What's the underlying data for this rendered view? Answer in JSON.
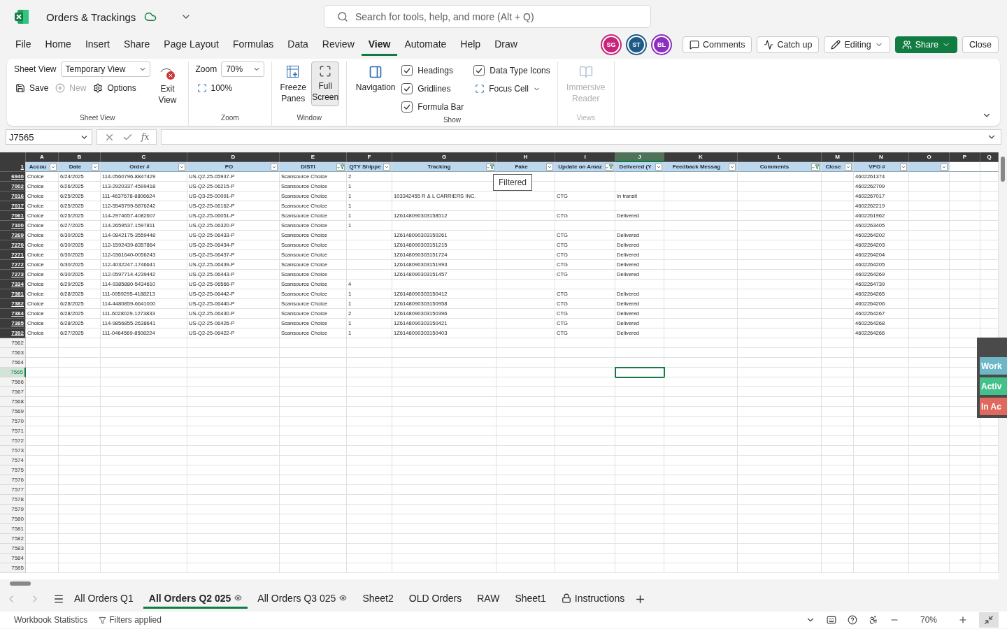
{
  "title_bar": {
    "document_title": "Orders & Trackings",
    "search_placeholder": "Search for tools, help, and more (Alt + Q)"
  },
  "menu": [
    {
      "label": "File",
      "selected": false
    },
    {
      "label": "Home",
      "selected": false
    },
    {
      "label": "Insert",
      "selected": false
    },
    {
      "label": "Share",
      "selected": false
    },
    {
      "label": "Page Layout",
      "selected": false
    },
    {
      "label": "Formulas",
      "selected": false
    },
    {
      "label": "Data",
      "selected": false
    },
    {
      "label": "Review",
      "selected": false
    },
    {
      "label": "View",
      "selected": true
    },
    {
      "label": "Automate",
      "selected": false
    },
    {
      "label": "Help",
      "selected": false
    },
    {
      "label": "Draw",
      "selected": false
    }
  ],
  "collaborators": [
    {
      "initials": "SG",
      "color": "#c8247a"
    },
    {
      "initials": "ST",
      "color": "#1d5a86"
    },
    {
      "initials": "BL",
      "color": "#8b2fc0"
    }
  ],
  "actions": [
    {
      "label": "Comments",
      "kind": "comments"
    },
    {
      "label": "Catch up",
      "kind": "catchup"
    },
    {
      "label": "Editing",
      "kind": "editing"
    },
    {
      "label": "Share",
      "kind": "primary"
    },
    {
      "label": "Close",
      "kind": "plain"
    }
  ],
  "ribbon": {
    "sheet_view": {
      "label": "Sheet View",
      "value": "Temporary View",
      "save": "Save",
      "new": {
        "label": "New",
        "disabled": true
      },
      "options": "Options",
      "exit": "Exit View",
      "group": "Sheet View"
    },
    "zoom": {
      "label": "Zoom",
      "value": "70%",
      "reset": "100%",
      "group": "Zoom"
    },
    "window": {
      "freeze": "Freeze Panes",
      "full_screen": {
        "label": "Full Screen",
        "selected": true
      },
      "group": "Window"
    },
    "show": {
      "navigation": "Navigation",
      "checkboxes": [
        {
          "label": "Headings",
          "checked": true
        },
        {
          "label": "Gridlines",
          "checked": true
        },
        {
          "label": "Formula Bar",
          "checked": true
        },
        {
          "label": "Data Type Icons",
          "checked": true
        }
      ],
      "focus_cell": "Focus Cell",
      "group": "Show"
    },
    "views": {
      "reader": {
        "label": "Immersive Reader",
        "disabled": true
      },
      "group": "Views"
    }
  },
  "formula_bar": {
    "name_box": "J7565",
    "function_label": "fx"
  },
  "sheet": {
    "header_row": "1",
    "columns": [
      {
        "letter": "A",
        "header": "Accou",
        "has_filter_button": true,
        "filtered": false,
        "selected": false
      },
      {
        "letter": "B",
        "header": "Date",
        "has_filter_button": true,
        "filtered": false,
        "selected": false
      },
      {
        "letter": "C",
        "header": "Order #",
        "has_filter_button": true,
        "filtered": false,
        "selected": false
      },
      {
        "letter": "D",
        "header": "PO",
        "has_filter_button": true,
        "filtered": false,
        "selected": false
      },
      {
        "letter": "E",
        "header": "DISTI",
        "has_filter_button": true,
        "filtered": true,
        "selected": false
      },
      {
        "letter": "F",
        "header": "QTY Shippe",
        "has_filter_button": true,
        "filtered": false,
        "selected": false
      },
      {
        "letter": "G",
        "header": "Tracking",
        "has_filter_button": true,
        "filtered": true,
        "selected": false
      },
      {
        "letter": "H",
        "header": "Fake",
        "has_filter_button": true,
        "filtered": false,
        "selected": false
      },
      {
        "letter": "I",
        "header": "Update on Amaz",
        "has_filter_button": true,
        "filtered": true,
        "selected": false
      },
      {
        "letter": "J",
        "header": "Delivered (Y",
        "has_filter_button": true,
        "filtered": false,
        "selected": true
      },
      {
        "letter": "K",
        "header": "Feedback Messag",
        "has_filter_button": true,
        "filtered": false,
        "selected": false
      },
      {
        "letter": "L",
        "header": "Comments",
        "has_filter_button": true,
        "filtered": true,
        "selected": false
      },
      {
        "letter": "M",
        "header": "Close",
        "has_filter_button": true,
        "filtered": false,
        "selected": false
      },
      {
        "letter": "N",
        "header": "VPO #",
        "has_filter_button": true,
        "filtered": false,
        "selected": false
      },
      {
        "letter": "O",
        "has_filter_button": true,
        "filtered": false,
        "selected": false
      },
      {
        "letter": "P",
        "has_filter_button": false,
        "selected": false
      },
      {
        "letter": "Q",
        "has_filter_button": false,
        "selected": false
      }
    ],
    "rows": [
      {
        "num": "6940",
        "cells": {
          "A": "Choice",
          "B": "6/24/2025",
          "C": "114-0560796-8847429",
          "D": "US-Q2-25-05937-P",
          "E": "Scansource Choice",
          "F": "2",
          "N": "4602261374"
        }
      },
      {
        "num": "7002",
        "cells": {
          "A": "Choice",
          "B": "6/26/2025",
          "C": "113-2920337-4599418",
          "D": "US-Q2-25-06215-P",
          "E": "Scansource Choice",
          "F": "1",
          "N": "4602262709"
        }
      },
      {
        "num": "7016",
        "cells": {
          "A": "Choice",
          "B": "6/25/2025",
          "C": "111-4637678-8806624",
          "D": "US-Q3-25-00091-P",
          "E": "Scansource Choice",
          "F": "1",
          "G": "103342455 R & L CARRIERS INC.",
          "I": "CTG",
          "J": "In transit",
          "N": "4602267017"
        }
      },
      {
        "num": "7017",
        "cells": {
          "A": "Choice",
          "B": "6/25/2025",
          "C": "112-5545799-5876242",
          "D": "US-Q2-25-06162-P",
          "E": "Scansource Choice",
          "F": "1",
          "N": "4602262219"
        }
      },
      {
        "num": "7061",
        "cells": {
          "A": "Choice",
          "B": "6/25/2025",
          "C": "114-2974657-4082607",
          "D": "US-Q2-25-06051-P",
          "E": "Scansource Choice",
          "F": "1",
          "G": "1Z6148090303158512",
          "I": "CTG",
          "J": "Delivered",
          "N": "4602261962"
        }
      },
      {
        "num": "7100",
        "cells": {
          "A": "Choice",
          "B": "6/27/2025",
          "C": "114-2659537-1597811",
          "D": "US-Q2-25-06320-P",
          "E": "Scansource Choice",
          "F": "1",
          "N": "4602263405"
        }
      },
      {
        "num": "7269",
        "cells": {
          "A": "Choice",
          "B": "6/30/2025",
          "C": "114-0842175-3559448",
          "D": "US-Q2-25-06433-P",
          "E": "Scansource Choice",
          "G": "1Z6148090303150261",
          "I": "CTG",
          "J": "Delivered",
          "N": "4602264202"
        }
      },
      {
        "num": "7270",
        "cells": {
          "A": "Choice",
          "B": "6/30/2025",
          "C": "112-1592439-8357864",
          "D": "US-Q2-25-06434-P",
          "E": "Scansource Choice",
          "G": "1Z6148090303151215",
          "I": "CTG",
          "J": "Delivered",
          "N": "4602264203"
        }
      },
      {
        "num": "7271",
        "cells": {
          "A": "Choice",
          "B": "6/30/2025",
          "C": "112-0361640-0056243",
          "D": "US-Q2-25-06437-P",
          "E": "Scansource Choice",
          "G": "1Z6148090303151724",
          "I": "CTG",
          "J": "Delivered",
          "N": "4602264204"
        }
      },
      {
        "num": "7272",
        "cells": {
          "A": "Choice",
          "B": "6/30/2025",
          "C": "112-4032247-1746641",
          "D": "US-Q2-25-06439-P",
          "E": "Scansource Choice",
          "G": "1Z6148090303151993",
          "I": "CTG",
          "J": "Delivered",
          "N": "4602264205"
        }
      },
      {
        "num": "7273",
        "cells": {
          "A": "Choice",
          "B": "6/30/2025",
          "C": "112-0597714-4239442",
          "D": "US-Q2-25-06443-P",
          "E": "Scansource Choice",
          "G": "1Z6148090303151457",
          "I": "CTG",
          "J": "Delivered",
          "N": "4602264269"
        }
      },
      {
        "num": "7334",
        "cells": {
          "A": "Choice",
          "B": "6/29/2025",
          "C": "114-9385880-5434610",
          "D": "US-Q2-25-06566-P",
          "E": "Scansource Choice",
          "F": "4",
          "N": "4602264739"
        }
      },
      {
        "num": "7381",
        "cells": {
          "A": "Choice",
          "B": "6/28/2025",
          "C": "111-0959295-4188213",
          "D": "US-Q2-25-06442-P",
          "E": "Scansource Choice",
          "F": "1",
          "G": "1Z6148090303150412",
          "I": "CTG",
          "J": "Delivered",
          "N": "4602264265"
        }
      },
      {
        "num": "7382",
        "cells": {
          "A": "Choice",
          "B": "6/28/2025",
          "C": "114-4480859-6641000",
          "D": "US-Q2-25-06440-P",
          "E": "Scansource Choice",
          "F": "1",
          "G": "1Z6148090303150958",
          "I": "CTG",
          "J": "Delivered",
          "N": "4602264206"
        }
      },
      {
        "num": "7384",
        "cells": {
          "A": "Choice",
          "B": "6/28/2025",
          "C": "111-6028029-1273833",
          "D": "US-Q2-25-06430-P",
          "E": "Scansource Choice",
          "F": "2",
          "G": "1Z6148090303150396",
          "I": "CTG",
          "J": "Delivered",
          "N": "4602264267"
        }
      },
      {
        "num": "7385",
        "cells": {
          "A": "Choice",
          "B": "6/28/2025",
          "C": "114-9856855-2638641",
          "D": "US-Q2-25-06426-P",
          "E": "Scansource Choice",
          "F": "1",
          "G": "1Z6148090303150421",
          "I": "CTG",
          "J": "Delivered",
          "N": "4602264268"
        }
      },
      {
        "num": "7392",
        "cells": {
          "A": "Choice",
          "B": "6/27/2025",
          "C": "111-0464569-8508224",
          "D": "US-Q2-25-06422-P",
          "E": "Scansource Choice",
          "F": "1",
          "G": "1Z6148090303150403",
          "I": "CTG",
          "J": "Delivered",
          "N": "4602264266"
        }
      }
    ],
    "empty_rows": [
      {
        "num": "7562",
        "selected": false
      },
      {
        "num": "7563",
        "selected": false
      },
      {
        "num": "7564",
        "selected": false
      },
      {
        "num": "7565",
        "selected": true
      },
      {
        "num": "7566",
        "selected": false
      },
      {
        "num": "7567",
        "selected": false
      },
      {
        "num": "7568",
        "selected": false
      },
      {
        "num": "7569",
        "selected": false
      },
      {
        "num": "7570",
        "selected": false
      },
      {
        "num": "7571",
        "selected": false
      },
      {
        "num": "7572",
        "selected": false
      },
      {
        "num": "7573",
        "selected": false
      },
      {
        "num": "7574",
        "selected": false
      },
      {
        "num": "7575",
        "selected": false
      },
      {
        "num": "7576",
        "selected": false
      },
      {
        "num": "7577",
        "selected": false
      },
      {
        "num": "7578",
        "selected": false
      },
      {
        "num": "7579",
        "selected": false
      },
      {
        "num": "7580",
        "selected": false
      },
      {
        "num": "7581",
        "selected": false
      },
      {
        "num": "7582",
        "selected": false
      },
      {
        "num": "7583",
        "selected": false
      },
      {
        "num": "7584",
        "selected": false
      },
      {
        "num": "7585",
        "selected": false
      }
    ],
    "tooltip": "Filtered",
    "side_panel": [
      {
        "label": "Work",
        "color": "#6fb7c6"
      },
      {
        "label": "Activ",
        "color": "#46c08a"
      },
      {
        "label": "In Ac",
        "color": "#e0695e"
      }
    ]
  },
  "sheet_tabs": [
    {
      "label": "All Orders Q1",
      "selected": false,
      "kind": "plain"
    },
    {
      "label": "All Orders Q2 025",
      "selected": true,
      "kind": "watched"
    },
    {
      "label": "All Orders Q3 025",
      "selected": false,
      "kind": "watched"
    },
    {
      "label": "Sheet2",
      "selected": false,
      "kind": "plain"
    },
    {
      "label": "OLD Orders",
      "selected": false,
      "kind": "plain"
    },
    {
      "label": "RAW",
      "selected": false,
      "kind": "plain"
    },
    {
      "label": "Sheet1",
      "selected": false,
      "kind": "plain"
    },
    {
      "label": "Instructions",
      "selected": false,
      "kind": "locked"
    }
  ],
  "status_bar": {
    "statistics": "Workbook Statistics",
    "filters": "Filters applied",
    "zoom": "70%"
  }
}
